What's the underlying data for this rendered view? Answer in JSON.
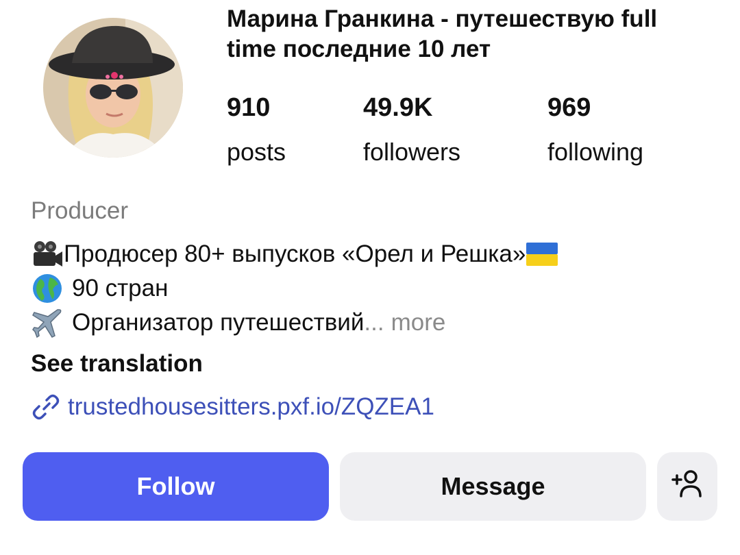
{
  "profile": {
    "name": "Марина Гранкина - путешествую full time последние 10 лет",
    "avatar_icon": "profile-avatar-photo"
  },
  "stats": {
    "posts": {
      "count": "910",
      "label": "posts"
    },
    "followers": {
      "count": "49.9K",
      "label": "followers"
    },
    "following": {
      "count": "969",
      "label": "following"
    }
  },
  "bio": {
    "category": "Producer",
    "line1_text": "Продюсер 80+ выпусков «Орел и Решка»",
    "line1_icon": "movie-camera-icon",
    "line1_trailing_icon": "ukraine-flag-icon",
    "line2_text": "90 стран",
    "line2_icon": "globe-icon",
    "line3_text": "Организатор путешествий",
    "line3_icon": "airplane-icon",
    "ellipsis": "...",
    "more_label": "more",
    "see_translation": "See translation",
    "link_icon": "link-icon",
    "link_text": "trustedhousesitters.pxf.io/ZQZEA1"
  },
  "actions": {
    "follow_label": "Follow",
    "message_label": "Message",
    "add_user_icon": "add-user-icon"
  },
  "colors": {
    "follow_button": "#4f5ef0",
    "secondary_button": "#efeff2",
    "link": "#3d50b8",
    "muted_text": "#7b7b7b"
  }
}
